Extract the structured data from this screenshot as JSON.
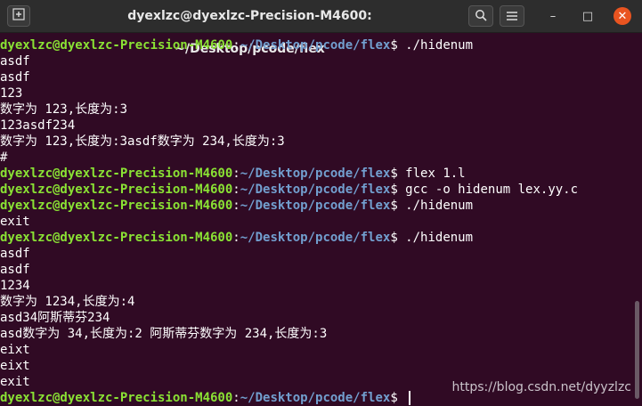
{
  "window": {
    "title": "dyexlzc@dyexlzc-Precision-M4600: ~/Desktop/pcode/flex",
    "new_tab_icon": "new-tab-icon",
    "search_icon": "search-icon",
    "menu_icon": "hamburger-menu-icon",
    "minimize_label": "–",
    "maximize_label": "□",
    "close_label": "✕"
  },
  "prompt": {
    "user_host": "dyexlzc@dyexlzc-Precision-M4600",
    "sep": ":",
    "path": "~/Desktop/pcode/flex",
    "dollar": "$ "
  },
  "lines": [
    {
      "type": "prompt",
      "cmd": "./hidenum"
    },
    {
      "type": "out",
      "text": "asdf"
    },
    {
      "type": "out",
      "text": "asdf"
    },
    {
      "type": "out",
      "text": "123"
    },
    {
      "type": "out",
      "text": "数字为 123,长度为:3"
    },
    {
      "type": "out",
      "text": "123asdf234"
    },
    {
      "type": "out",
      "text": "数字为 123,长度为:3asdf数字为 234,长度为:3"
    },
    {
      "type": "out",
      "text": "#"
    },
    {
      "type": "prompt",
      "cmd": "flex 1.l"
    },
    {
      "type": "prompt",
      "cmd": "gcc -o hidenum lex.yy.c"
    },
    {
      "type": "prompt",
      "cmd": "./hidenum"
    },
    {
      "type": "out",
      "text": "exit"
    },
    {
      "type": "prompt",
      "cmd": "./hidenum"
    },
    {
      "type": "out",
      "text": "asdf"
    },
    {
      "type": "out",
      "text": "asdf"
    },
    {
      "type": "out",
      "text": "1234"
    },
    {
      "type": "out",
      "text": "数字为 1234,长度为:4"
    },
    {
      "type": "out",
      "text": "asd34阿斯蒂芬234"
    },
    {
      "type": "out",
      "text": "asd数字为 34,长度为:2 阿斯蒂芬数字为 234,长度为:3"
    },
    {
      "type": "out",
      "text": "eixt"
    },
    {
      "type": "out",
      "text": "eixt"
    },
    {
      "type": "out",
      "text": "exit"
    },
    {
      "type": "prompt",
      "cmd": "",
      "cursor": true
    }
  ],
  "watermark": "https://blog.csdn.net/dyyzlzc"
}
